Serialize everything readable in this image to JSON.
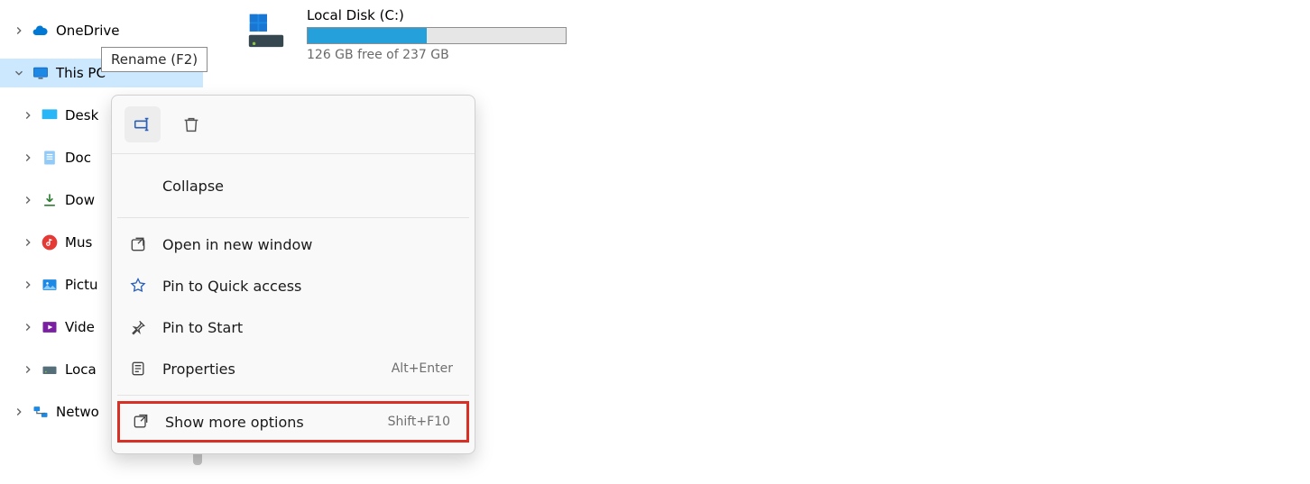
{
  "sidebar": {
    "onedrive": "OneDrive",
    "thispc": "This PC",
    "items": [
      "Desk",
      "Doc",
      "Dow",
      "Mus",
      "Pictu",
      "Vide",
      "Loca"
    ],
    "network": "Netwo"
  },
  "tooltip": "Rename (F2)",
  "disk": {
    "title": "Local Disk (C:)",
    "free": "126 GB free of 237 GB",
    "used_percent": 46
  },
  "context": {
    "collapse": "Collapse",
    "open_new_window": "Open in new window",
    "pin_quick": "Pin to Quick access",
    "pin_start": "Pin to Start",
    "properties": "Properties",
    "properties_shortcut": "Alt+Enter",
    "show_more": "Show more options",
    "show_more_shortcut": "Shift+F10"
  }
}
